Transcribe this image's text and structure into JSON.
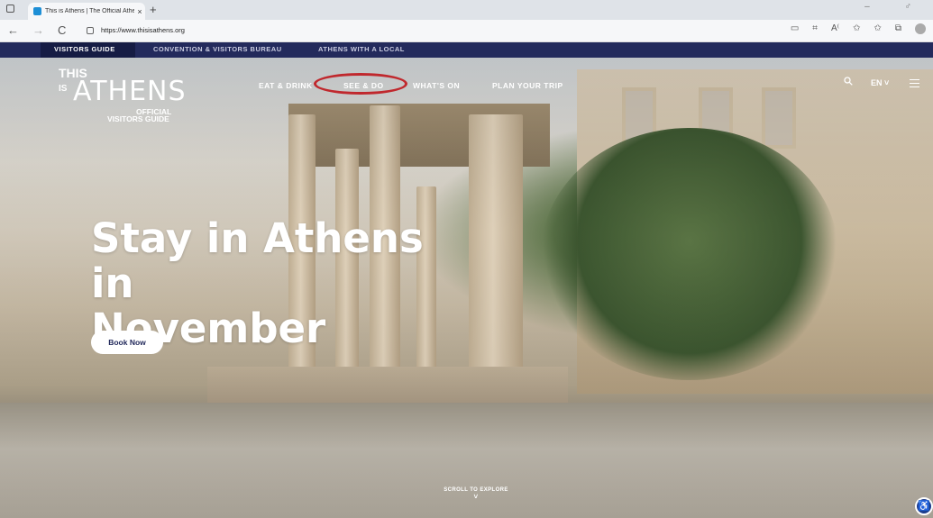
{
  "browser": {
    "tab_title": "This is Athens | The Official Athe",
    "tab_close": "×",
    "new_tab": "+",
    "back": "←",
    "forward": "→",
    "reload": "C",
    "url": "https://www.thisisathens.org",
    "window_controls": "–  ♂",
    "toolbar_icons": [
      "▭",
      "⌗",
      "A⁽",
      "✩",
      "✩",
      "⧉"
    ]
  },
  "topnav": {
    "items": [
      "VISITORS GUIDE",
      "CONVENTION & VISITORS BUREAU",
      "ATHENS WITH A LOCAL"
    ]
  },
  "logo": {
    "this": "THIS",
    "is": "IS",
    "athens": "ATHENS",
    "official": "OFFICIAL",
    "visitors_guide": "VISITORS GUIDE"
  },
  "mainnav": {
    "items": [
      "EAT & DRINK",
      "SEE & DO",
      "WHAT'S ON",
      "PLAN YOUR TRIP"
    ]
  },
  "header_right": {
    "search_icon": "search-icon",
    "language": "EN ˅"
  },
  "hero": {
    "headline_line1": "Stay in Athens in",
    "headline_line2": "November",
    "cta": "Book Now",
    "scroll": "SCROLL TO EXPLORE",
    "scroll_chevron": "˅"
  },
  "accessibility": "♿",
  "colors": {
    "nav_bg": "#232a5c",
    "highlight": "#c0282d"
  }
}
